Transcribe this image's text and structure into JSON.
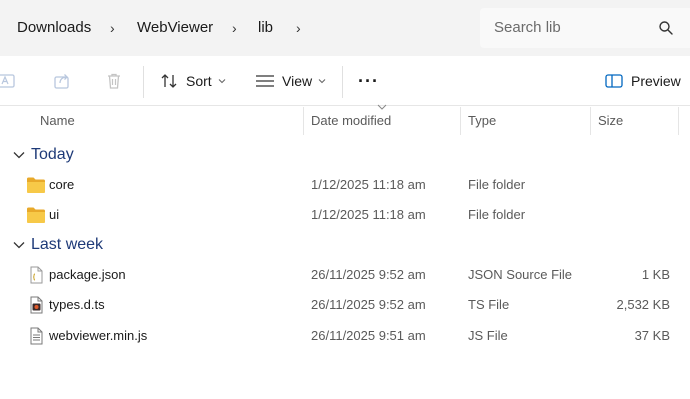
{
  "breadcrumb": {
    "items": [
      {
        "label": "Downloads"
      },
      {
        "label": "WebViewer"
      },
      {
        "label": "lib"
      }
    ]
  },
  "search": {
    "placeholder": "Search lib"
  },
  "toolbar": {
    "sort_label": "Sort",
    "view_label": "View",
    "more_label": "···",
    "preview_label": "Preview"
  },
  "columns": {
    "name": "Name",
    "date_modified": "Date modified",
    "type": "Type",
    "size": "Size"
  },
  "groups": [
    {
      "label": "Today",
      "items": [
        {
          "name": "core",
          "date": "1/12/2025 11:18 am",
          "type": "File folder",
          "size": "",
          "icon": "folder-icon"
        },
        {
          "name": "ui",
          "date": "1/12/2025 11:18 am",
          "type": "File folder",
          "size": "",
          "icon": "folder-icon"
        }
      ]
    },
    {
      "label": "Last week",
      "items": [
        {
          "name": "package.json",
          "date": "26/11/2025 9:52 am",
          "type": "JSON Source File",
          "size": "1 KB",
          "icon": "json-file-icon"
        },
        {
          "name": "types.d.ts",
          "date": "26/11/2025 9:52 am",
          "type": "TS File",
          "size": "2,532 KB",
          "icon": "ts-file-icon"
        },
        {
          "name": "webviewer.min.js",
          "date": "26/11/2025 9:51 am",
          "type": "JS File",
          "size": "37 KB",
          "icon": "js-file-icon"
        }
      ]
    }
  ],
  "colors": {
    "group_label": "#1e3a78",
    "folder": "#f7c948",
    "accent": "#0067c0"
  }
}
